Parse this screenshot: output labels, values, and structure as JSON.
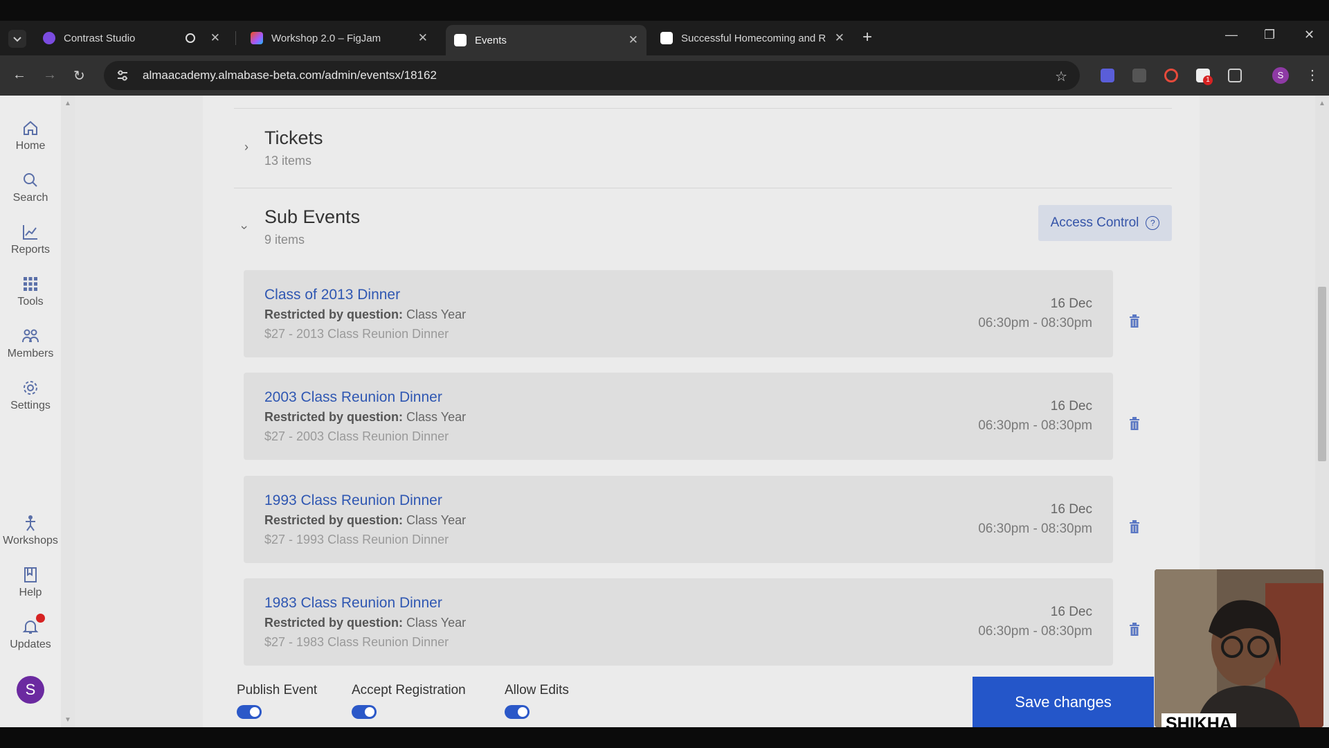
{
  "browser": {
    "tabs": [
      {
        "title": "Contrast Studio",
        "favicon_color": "#7b4ce0"
      },
      {
        "title": "Workshop 2.0 – FigJam",
        "favicon_color": "#f24e1e"
      },
      {
        "title": "Events",
        "favicon_color": "#ffffff"
      },
      {
        "title": "Successful Homecoming and R",
        "favicon_color": "#ffffff"
      }
    ],
    "active_tab": 2,
    "url": "almaacademy.almabase-beta.com/admin/eventsx/18162",
    "profile_initial": "S",
    "extension_badge": "1"
  },
  "sidebar": {
    "items": [
      {
        "label": "Home",
        "icon": "home-icon"
      },
      {
        "label": "Search",
        "icon": "search-icon"
      },
      {
        "label": "Reports",
        "icon": "chart-icon"
      },
      {
        "label": "Tools",
        "icon": "grid-icon"
      },
      {
        "label": "Members",
        "icon": "members-icon"
      },
      {
        "label": "Settings",
        "icon": "gear-icon"
      },
      {
        "label": "Workshops",
        "icon": "workshop-icon"
      },
      {
        "label": "Help",
        "icon": "book-icon"
      },
      {
        "label": "Updates",
        "icon": "bell-icon"
      }
    ],
    "avatar_initial": "S"
  },
  "tickets": {
    "title": "Tickets",
    "count": "13 items"
  },
  "sub_events": {
    "title": "Sub Events",
    "count": "9 items",
    "access_control_label": "Access Control",
    "items": [
      {
        "title": "Class of 2013 Dinner",
        "restrict_label": "Restricted by question:",
        "restrict_value": "Class Year",
        "price": "$27 - 2013 Class Reunion Dinner",
        "date": "16 Dec",
        "time": "06:30pm - 08:30pm"
      },
      {
        "title": "2003 Class Reunion Dinner",
        "restrict_label": "Restricted by question:",
        "restrict_value": "Class Year",
        "price": "$27 - 2003 Class Reunion Dinner",
        "date": "16 Dec",
        "time": "06:30pm - 08:30pm"
      },
      {
        "title": "1993 Class Reunion Dinner",
        "restrict_label": "Restricted by question:",
        "restrict_value": "Class Year",
        "price": "$27 - 1993 Class Reunion Dinner",
        "date": "16 Dec",
        "time": "06:30pm - 08:30pm"
      },
      {
        "title": "1983 Class Reunion Dinner",
        "restrict_label": "Restricted by question:",
        "restrict_value": "Class Year",
        "price": "$27 - 1983 Class Reunion Dinner",
        "date": "16 Dec",
        "time": "06:30pm - 08:30pm"
      }
    ]
  },
  "footer": {
    "toggles": [
      {
        "label": "Publish Event",
        "on": true
      },
      {
        "label": "Accept Registration",
        "on": true
      },
      {
        "label": "Allow Edits",
        "on": true
      }
    ],
    "save_label": "Save changes"
  },
  "webcam": {
    "name": "SHIKHA"
  },
  "colors": {
    "accent": "#2456c9",
    "link": "#2f57b2",
    "alert": "#d62222"
  }
}
